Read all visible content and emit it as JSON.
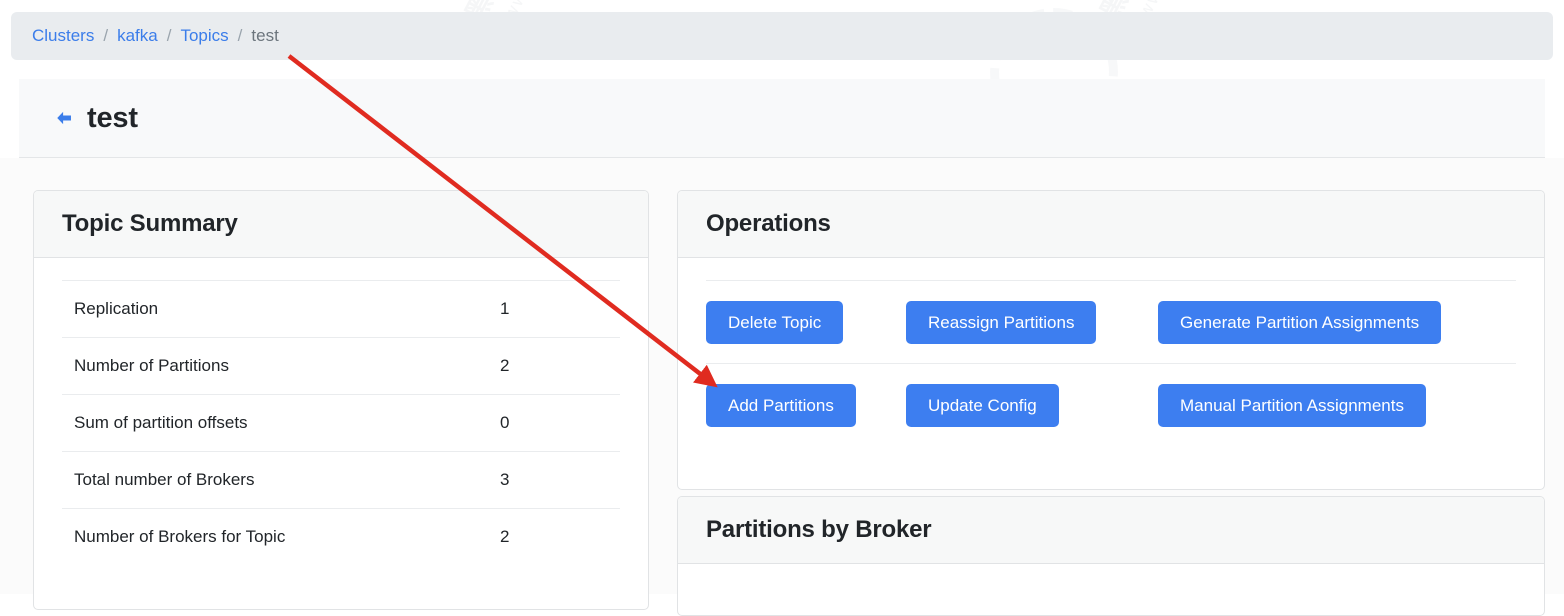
{
  "breadcrumb": {
    "separator": "/",
    "items": [
      {
        "label": "Clusters",
        "type": "link"
      },
      {
        "label": "kafka",
        "type": "link"
      },
      {
        "label": "Topics",
        "type": "link"
      },
      {
        "label": "test",
        "type": "current"
      }
    ]
  },
  "page": {
    "title": "test",
    "back_icon": "back-arrow-icon"
  },
  "topic_summary": {
    "title": "Topic Summary",
    "rows": [
      {
        "label": "Replication",
        "value": "1"
      },
      {
        "label": "Number of Partitions",
        "value": "2"
      },
      {
        "label": "Sum of partition offsets",
        "value": "0"
      },
      {
        "label": "Total number of Brokers",
        "value": "3"
      },
      {
        "label": "Number of Brokers for Topic",
        "value": "2"
      }
    ]
  },
  "operations": {
    "title": "Operations",
    "row1": [
      {
        "label": "Delete Topic"
      },
      {
        "label": "Reassign Partitions"
      },
      {
        "label": "Generate Partition Assignments"
      }
    ],
    "row2": [
      {
        "label": "Add Partitions"
      },
      {
        "label": "Update Config"
      },
      {
        "label": "Manual Partition Assignments"
      }
    ]
  },
  "partitions_by_broker": {
    "title": "Partitions by Broker"
  },
  "annotation": {
    "type": "arrow",
    "color": "#e02b20",
    "points_to": "Add Partitions"
  },
  "colors": {
    "primary_button": "#3d7ef0",
    "link": "#3b7dea",
    "breadcrumb_bg": "#e9ecef",
    "annotation_red": "#e02b20",
    "text": "#212529",
    "muted_text": "#6c757d"
  },
  "watermark": {
    "text_cn": "黑马程序员",
    "text_url": "www.itheima.com"
  }
}
